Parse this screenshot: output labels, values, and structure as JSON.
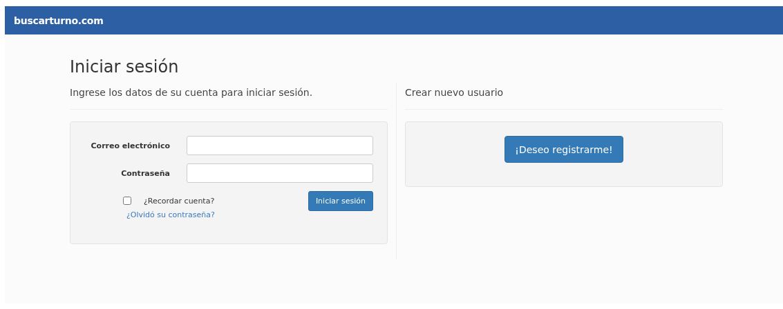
{
  "navbar": {
    "brand": "buscarturno.com"
  },
  "login": {
    "title": "Iniciar sesión",
    "subtitle": "Ingrese los datos de su cuenta para iniciar sesión.",
    "fields": [
      {
        "label": "Correo electrónico"
      },
      {
        "label": "Contraseña"
      }
    ],
    "remember": {
      "label": "¿Recordar cuenta?",
      "checked": false
    },
    "submit": "Iniciar sesión",
    "forgot": "¿Olvidó su contraseña?"
  },
  "register": {
    "heading": "Crear nuevo usuario",
    "button": "¡Deseo registrarme!"
  }
}
